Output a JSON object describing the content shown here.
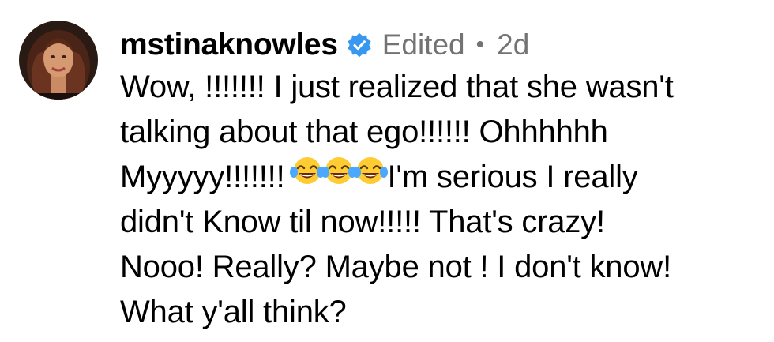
{
  "comment": {
    "username": "mstinaknowles",
    "edited_label": "Edited",
    "separator": "•",
    "timestamp": "2d",
    "verified_icon": "verified-badge-icon",
    "avatar_icon": "user-avatar-photo",
    "emoji_icon": "face-with-tears-of-joy-emoji",
    "lines": [
      "Wow, !!!!!!! I just realized that she wasn't",
      "talking about that ego!!!!!! Ohhhhhh",
      "Myyyyy!!!!!!!",
      "I'm serious I really",
      "didn't Know til now!!!!! That's crazy!",
      "Nooo! Really? Maybe not ! I don't know!",
      "What y'all think?"
    ]
  },
  "colors": {
    "verified_blue": "#3897f0",
    "secondary_text": "#737373",
    "text": "#000000"
  }
}
